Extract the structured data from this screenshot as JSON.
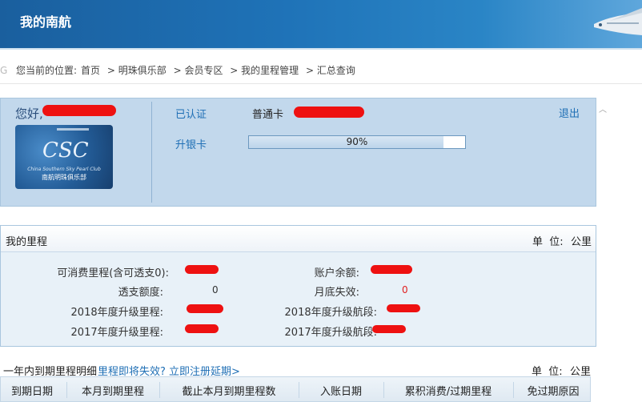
{
  "header": {
    "title": "我的南航"
  },
  "breadcrumb": {
    "prefix": "您当前的位置:",
    "items": [
      "首页",
      "> 明珠俱乐部",
      "> 会员专区",
      "> 我的里程管理",
      "> 汇总查询"
    ]
  },
  "profile": {
    "greeting": "您好,",
    "certified": "已认证",
    "card_type": "普通卡",
    "logout": "退出",
    "upgrade_label": "升银卡",
    "progress_text": "90%",
    "progress_value": 0.9,
    "card": {
      "logo": "CSC",
      "line1": "China Southern Sky Pearl Club",
      "line2": "南航明珠俱乐部"
    }
  },
  "miles": {
    "title": "我的里程",
    "unit_label": "单  位:",
    "unit_value": "公里",
    "rows_left": [
      {
        "label": "可消费里程(含可透支0):",
        "value": ""
      },
      {
        "label": "透支额度:",
        "value": "0"
      },
      {
        "label": "2018年度升级里程:",
        "value": ""
      },
      {
        "label": "2017年度升级里程:",
        "value": ""
      }
    ],
    "rows_right": [
      {
        "label": "账户余额:",
        "value": ""
      },
      {
        "label": "月底失效:",
        "value": "0"
      },
      {
        "label": "2018年度升级航段:",
        "value": ""
      },
      {
        "label": "2017年度升级航段:",
        "value": ""
      }
    ]
  },
  "expiry": {
    "title": "一年内到期里程明细",
    "link": "里程即将失效? 立即注册延期>",
    "unit_label": "单  位:",
    "unit_value": "公里",
    "columns": [
      "到期日期",
      "本月到期里程",
      "截止本月到期里程数",
      "入账日期",
      "累积消费/过期里程",
      "免过期原因"
    ]
  },
  "colors": {
    "header": "#1f73b8",
    "panel": "#c2d8ec",
    "link": "#1f6fb5",
    "alert": "#e02020"
  }
}
